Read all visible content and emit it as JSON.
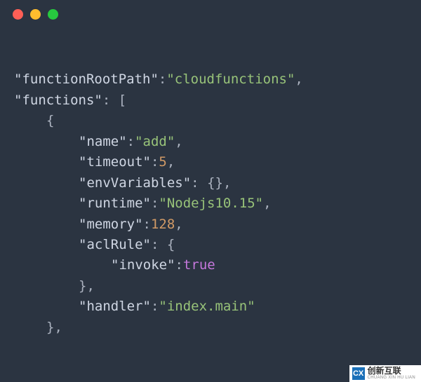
{
  "titlebar": {
    "close_name": "close",
    "minimize_name": "minimize",
    "zoom_name": "zoom"
  },
  "code": {
    "functionRootPath": {
      "key": "\"functionRootPath\"",
      "val": "\"cloudfunctions\""
    },
    "functions": {
      "key": "\"functions\""
    },
    "name": {
      "key": "\"name\"",
      "val": "\"add\""
    },
    "timeout": {
      "key": "\"timeout\"",
      "val": "5"
    },
    "envVariables": {
      "key": "\"envVariables\"",
      "val": "{}"
    },
    "runtime": {
      "key": "\"runtime\"",
      "val": "\"Nodejs10.15\""
    },
    "memory": {
      "key": "\"memory\"",
      "val": "128"
    },
    "aclRule": {
      "key": "\"aclRule\""
    },
    "invoke": {
      "key": "\"invoke\"",
      "val": "true"
    },
    "handler": {
      "key": "\"handler\"",
      "val": "\"index.main\""
    },
    "brace_open": "{",
    "brace_close_comma": "},",
    "bracket_open": "[",
    "colon": ":",
    "comma": ","
  },
  "watermark": {
    "logo": "CX",
    "cn": "创新互联",
    "en": "CHUANG XIN HU LIAN"
  }
}
